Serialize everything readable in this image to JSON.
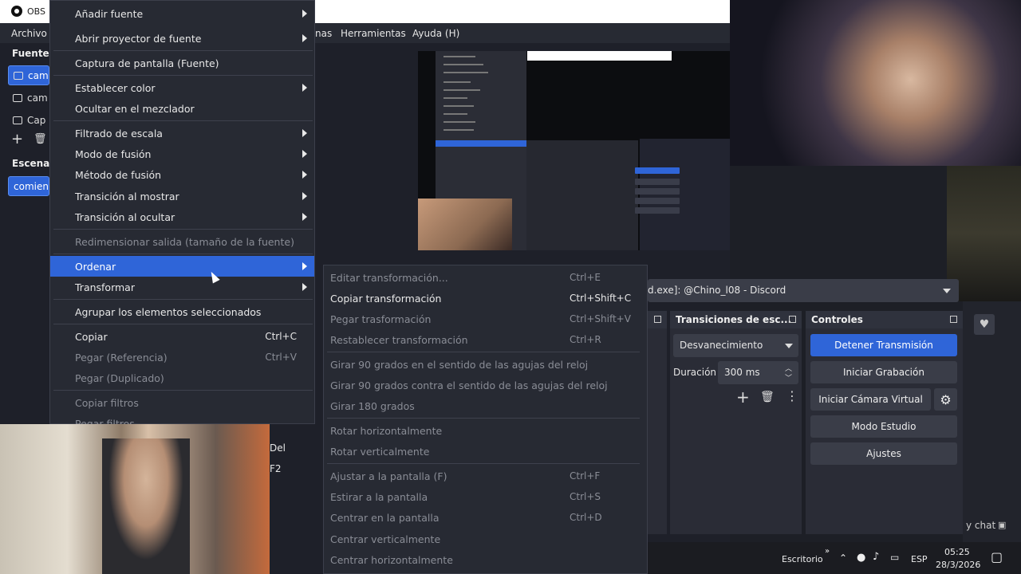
{
  "app": {
    "title": "OBS"
  },
  "menubar": {
    "file": "Archivo",
    "scenes": "nas",
    "tools": "Herramientas",
    "help": "Ayuda (H)"
  },
  "docks": {
    "sources_title": "Fuente",
    "sources": [
      "cam",
      "cam",
      "Cap"
    ],
    "scenes_title": "Escenas",
    "scene_item": "comien",
    "transitions_title": "Transiciones de esc...",
    "controls_title": "Controles"
  },
  "source_combo": {
    "value": "d.exe]: @Chino_l08 - Discord"
  },
  "transitions": {
    "type": "Desvanecimiento",
    "duration_label": "Duración",
    "duration_value": "300 ms"
  },
  "controls": {
    "stop_stream": "Detener Transmisión",
    "start_record": "Iniciar Grabación",
    "start_virtualcam": "Iniciar Cámara Virtual",
    "studio_mode": "Modo Estudio",
    "settings": "Ajustes"
  },
  "context_menu": {
    "items": [
      {
        "label": "Añadir fuente",
        "submenu": true
      },
      {
        "label": "Abrir proyector de fuente",
        "submenu": true
      },
      {
        "label": "Captura de pantalla (Fuente)"
      },
      {
        "label": "Establecer color",
        "submenu": true
      },
      {
        "label": "Ocultar en el mezclador"
      },
      {
        "label": "Filtrado de escala",
        "submenu": true
      },
      {
        "label": "Modo de fusión",
        "submenu": true
      },
      {
        "label": "Método de fusión",
        "submenu": true
      },
      {
        "label": "Transición al mostrar",
        "submenu": true
      },
      {
        "label": "Transición al ocultar",
        "submenu": true
      },
      {
        "label": "Redimensionar salida (tamaño de la fuente)",
        "disabled": true
      },
      {
        "label": "Ordenar",
        "submenu": true,
        "highlighted": true
      },
      {
        "label": "Transformar",
        "submenu": true
      },
      {
        "label": "Agrupar los elementos seleccionados"
      },
      {
        "label": "Copiar",
        "shortcut": "Ctrl+C"
      },
      {
        "label": "Pegar (Referencia)",
        "shortcut": "Ctrl+V",
        "disabled": true
      },
      {
        "label": "Pegar (Duplicado)",
        "disabled": true
      },
      {
        "label": "Copiar filtros",
        "disabled": true
      },
      {
        "label": "Pegar filtros",
        "disabled": true
      }
    ],
    "hidden_shortcuts": [
      "Del",
      "F2"
    ]
  },
  "submenu": {
    "items": [
      {
        "label": "Editar transformación...",
        "shortcut": "Ctrl+E"
      },
      {
        "label": "Copiar transformación",
        "shortcut": "Ctrl+Shift+C",
        "enabled": true
      },
      {
        "label": "Pegar trasformación",
        "shortcut": "Ctrl+Shift+V"
      },
      {
        "label": "Restablecer transformación",
        "shortcut": "Ctrl+R"
      },
      {
        "label": "Girar 90 grados en el sentido de las agujas del reloj"
      },
      {
        "label": "Girar 90 grados contra el sentido de las agujas del reloj"
      },
      {
        "label": "Girar 180 grados"
      },
      {
        "label": "Rotar horizontalmente"
      },
      {
        "label": "Rotar verticalmente"
      },
      {
        "label": "Ajustar a la pantalla (F)",
        "shortcut": "Ctrl+F"
      },
      {
        "label": "Estirar a la pantalla",
        "shortcut": "Ctrl+S"
      },
      {
        "label": "Centrar en la pantalla",
        "shortcut": "Ctrl+D"
      },
      {
        "label": "Centrar verticalmente"
      },
      {
        "label": "Centrar horizontalmente"
      }
    ]
  },
  "side_text": {
    "chat": "y chat"
  },
  "taskbar": {
    "escritorio": "Escritorio",
    "lang": "ESP",
    "time": "05:25",
    "date": "28/3/2026"
  }
}
